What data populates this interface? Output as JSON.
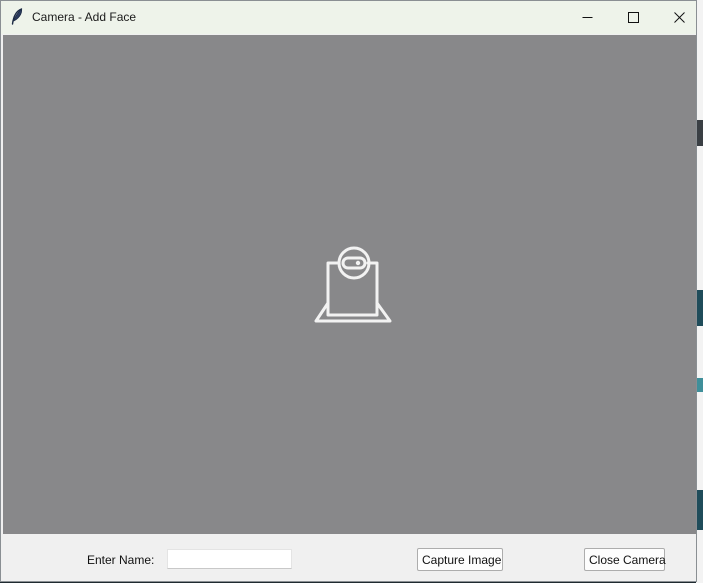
{
  "window": {
    "title": "Camera - Add Face",
    "controls": {
      "minimize_icon": "minimize-icon",
      "maximize_icon": "maximize-icon",
      "close_icon": "close-icon"
    },
    "app_icon": "feather-icon"
  },
  "camera_view": {
    "placeholder_icon": "webcam-icon",
    "background_color": "#88888a",
    "icon_color": "#f2f2f2"
  },
  "form": {
    "name_label": "Enter Name:",
    "name_value": "",
    "capture_label": "Capture Image",
    "close_label": "Close Camera"
  }
}
